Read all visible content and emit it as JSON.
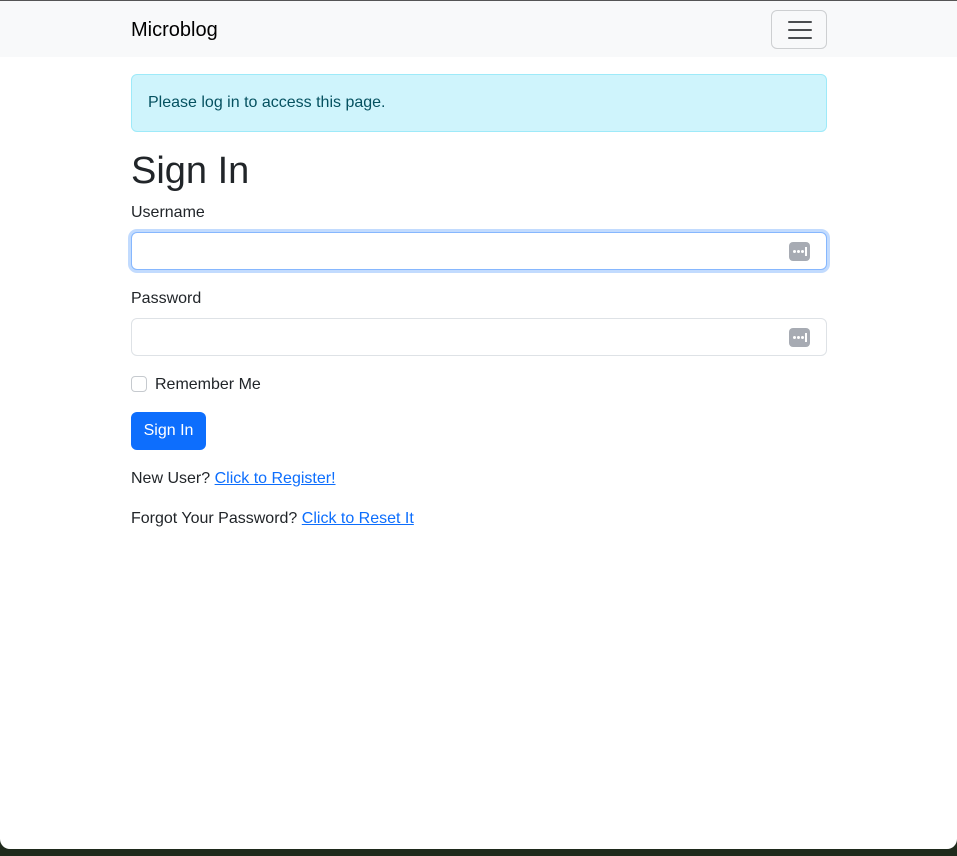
{
  "navbar": {
    "brand": "Microblog",
    "toggler_icon": "hamburger-menu-icon"
  },
  "alert": {
    "message": "Please log in to access this page."
  },
  "form": {
    "title": "Sign In",
    "username_label": "Username",
    "username_value": "",
    "password_label": "Password",
    "password_value": "",
    "autofill_icon": "password-autofill-key-icon",
    "remember_label": "Remember Me",
    "remember_checked": false,
    "submit_label": "Sign In"
  },
  "links": {
    "register_prompt": "New User?",
    "register_link": "Click to Register!",
    "reset_prompt": "Forgot Your Password?",
    "reset_link": "Click to Reset It"
  },
  "colors": {
    "primary": "#0d6efd",
    "alert_bg": "#cff4fc",
    "alert_text": "#055160",
    "navbar_bg": "#f8f9fa"
  }
}
